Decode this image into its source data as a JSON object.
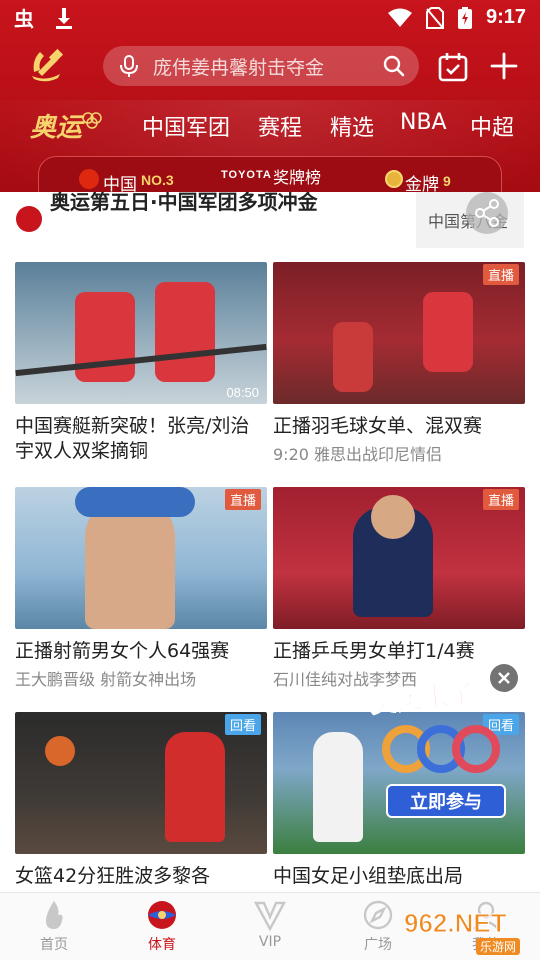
{
  "status_bar": {
    "time": "9:17"
  },
  "search": {
    "placeholder": "庞伟姜冉馨射击夺金"
  },
  "tabs": [
    "中国军团",
    "赛程",
    "精选",
    "NBA",
    "中超"
  ],
  "olympic_logo_text": "奥运",
  "medal_bar": {
    "country": "中国",
    "rank": "NO.3",
    "sponsor": "TOYOTA",
    "title": "奖牌榜",
    "gold_label": "金牌",
    "gold_count": "9"
  },
  "headline": {
    "text": "奥运第五日·中国军团多项冲金",
    "thumb_text": "中国第八金"
  },
  "cards": [
    {
      "title": "中国赛艇新突破！张亮/刘治宇双人双桨摘铜",
      "sub": "",
      "badge": "",
      "duration": "08:50"
    },
    {
      "title": "正播羽毛球女单、混双赛",
      "sub": "9:20 雅思出战印尼情侣",
      "badge": "直播",
      "duration": ""
    },
    {
      "title": "正播射箭男女个人64强赛",
      "sub": "王大鹏晋级 射箭女神出场",
      "badge": "直播",
      "duration": ""
    },
    {
      "title": "正播乒乓男女单打1/4赛",
      "sub": "石川佳纯对战李梦西",
      "badge": "直播",
      "duration": ""
    },
    {
      "title": "女篮42分狂胜波多黎各",
      "sub": "",
      "badge": "回看",
      "duration": ""
    },
    {
      "title": "中国女足小组垫底出局",
      "sub": "",
      "badge": "回看",
      "duration": ""
    }
  ],
  "promo": {
    "headline": "奥运来了",
    "button": "立即参与"
  },
  "bottom_nav": [
    {
      "label": "首页",
      "icon": "flame-icon"
    },
    {
      "label": "体育",
      "icon": "ball-icon"
    },
    {
      "label": "VIP",
      "icon": "vip-icon"
    },
    {
      "label": "广场",
      "icon": "compass-icon"
    },
    {
      "label": "我的",
      "icon": "user-icon"
    }
  ],
  "watermark": {
    "big": "962.NET",
    "small": "乐游网"
  },
  "colors": {
    "brand_red": "#c8141c",
    "gold": "#f6d36b",
    "live_badge": "#e15a3e",
    "replay_badge": "#4aa6e8"
  }
}
